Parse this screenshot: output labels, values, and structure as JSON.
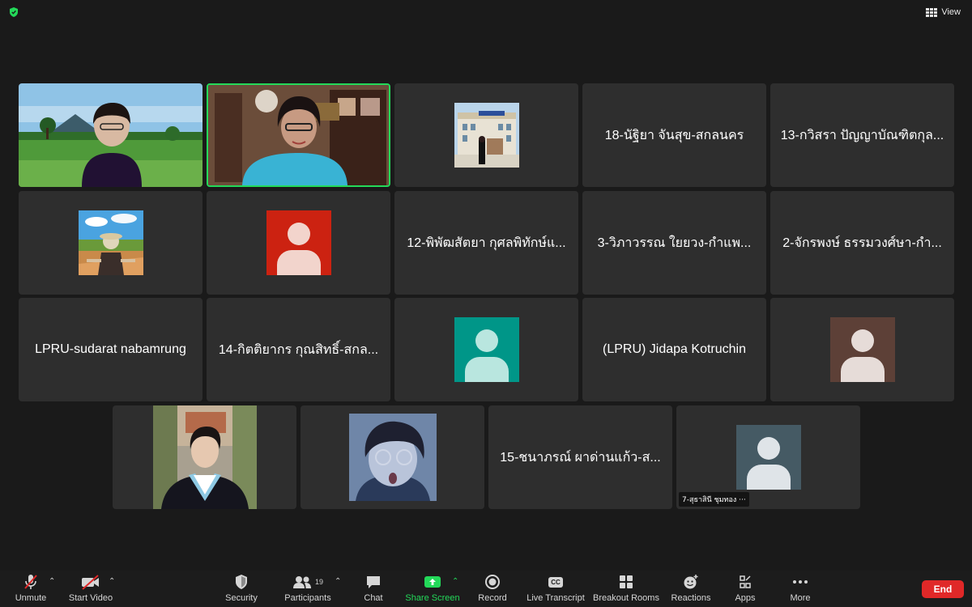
{
  "top": {
    "view_label": "View"
  },
  "tiles": {
    "t1": {
      "name": "",
      "icon": "video-feed"
    },
    "t2": {
      "name": "",
      "icon": "video-feed"
    },
    "t3": {
      "name": "",
      "icon": "profile-photo"
    },
    "t4": {
      "name": "18-นัฐิยา จันสุข-สกลนคร"
    },
    "t5": {
      "name": "13-กวิสรา ปัญญาบัณฑิตกุล..."
    },
    "t6": {
      "name": "",
      "icon": "profile-photo"
    },
    "t7": {
      "name": "",
      "icon": "default-avatar",
      "color": "#cc2211"
    },
    "t8": {
      "name": "12-พิพัฒสัตยา กุศลพิทักษ์แ..."
    },
    "t9": {
      "name": "3-วิภาวรรณ ใยยวง-กำแพ..."
    },
    "t10": {
      "name": "2-จักรพงษ์ ธรรมวงศ์ษา-กำ..."
    },
    "t11": {
      "name": "LPRU-sudarat nabamrung"
    },
    "t12": {
      "name": "14-กิตติยากร กุณสิทธิ์-สกล..."
    },
    "t13": {
      "name": "",
      "icon": "default-avatar",
      "color": "#009688"
    },
    "t14": {
      "name": "(LPRU) Jidapa Kotruchin"
    },
    "t15": {
      "name": "",
      "icon": "default-avatar",
      "color": "#5d4037"
    },
    "t16": {
      "name": "",
      "icon": "profile-photo"
    },
    "t17": {
      "name": "",
      "icon": "profile-photo"
    },
    "t18": {
      "name": "15-ชนาภรณ์ ผาด่านแก้ว-ส..."
    },
    "t19": {
      "name": "7-สุธาสินี ชุมทอง ···",
      "icon": "default-avatar",
      "color": "#455a64"
    }
  },
  "toolbar": {
    "unmute": "Unmute",
    "start_video": "Start Video",
    "security": "Security",
    "participants": "Participants",
    "participants_count": "19",
    "chat": "Chat",
    "share_screen": "Share Screen",
    "record": "Record",
    "live_transcript": "Live Transcript",
    "live_transcript_icon_text": "CC",
    "breakout_rooms": "Breakout Rooms",
    "reactions": "Reactions",
    "apps": "Apps",
    "more": "More",
    "end": "End"
  },
  "colors": {
    "active_speaker": "#23d959",
    "end_button": "#e02828",
    "share_green": "#23d959"
  }
}
